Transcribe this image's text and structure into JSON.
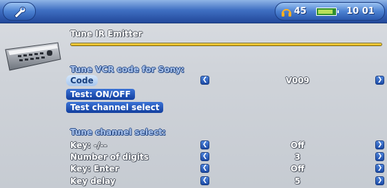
{
  "header": {
    "volume_icon": "headphones-icon",
    "volume": "45",
    "battery_icon": "battery-icon",
    "battery_level": 0.8,
    "clock": "10 01"
  },
  "page": {
    "title": "Tune IR Emitter",
    "progress": 1.0
  },
  "vcr_section": {
    "title": "Tune VCR code for Sony:",
    "code_label": "Code",
    "code_value": "V009",
    "test_onoff": "Test: ON/OFF",
    "test_channel": "Test channel select"
  },
  "channel_section": {
    "title": "Tune channel select:",
    "rows": [
      {
        "label": "Key: -/--",
        "value": "Off"
      },
      {
        "label": "Number of digits",
        "value": "3"
      },
      {
        "label": "Key: Enter",
        "value": "Off"
      },
      {
        "label": "Key delay",
        "value": "5"
      }
    ]
  },
  "colors": {
    "topbar": "#3f6fc2",
    "selection_blue": "#1a4aa8",
    "progress_gold": "#e6a800"
  }
}
